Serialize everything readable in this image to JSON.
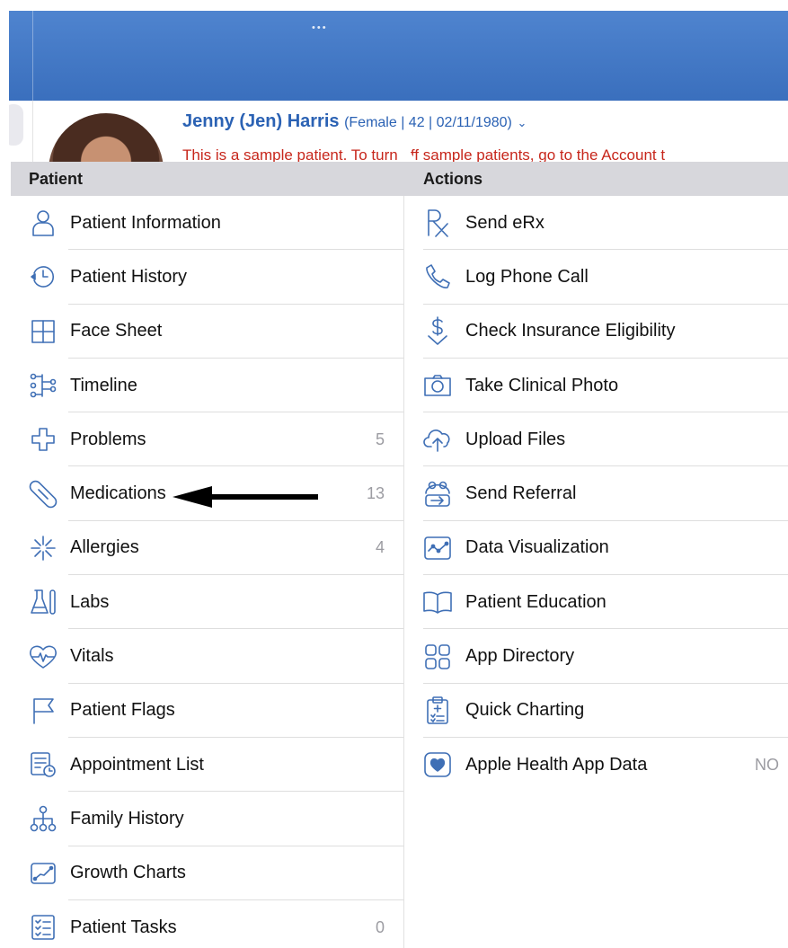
{
  "patient": {
    "name": "Jenny (Jen) Harris",
    "demographics": "(Female | 42 | 02/11/1980)",
    "chevron": "⌄",
    "sample_notice": "This is a sample patient. To turn off sample patients, go to the Account t"
  },
  "topbar": {
    "dots": "•••"
  },
  "sections": {
    "patient_header": "Patient",
    "actions_header": "Actions"
  },
  "patient_items": [
    {
      "label": "Patient Information",
      "icon": "person-icon",
      "count": ""
    },
    {
      "label": "Patient History",
      "icon": "history-clock-icon",
      "count": ""
    },
    {
      "label": "Face Sheet",
      "icon": "grid-icon",
      "count": ""
    },
    {
      "label": "Timeline",
      "icon": "timeline-icon",
      "count": ""
    },
    {
      "label": "Problems",
      "icon": "medical-cross-icon",
      "count": "5"
    },
    {
      "label": "Medications",
      "icon": "pill-icon",
      "count": "13"
    },
    {
      "label": "Allergies",
      "icon": "allergy-burst-icon",
      "count": "4"
    },
    {
      "label": "Labs",
      "icon": "lab-flask-icon",
      "count": ""
    },
    {
      "label": "Vitals",
      "icon": "heart-pulse-icon",
      "count": ""
    },
    {
      "label": "Patient Flags",
      "icon": "flag-icon",
      "count": ""
    },
    {
      "label": "Appointment List",
      "icon": "appointment-list-icon",
      "count": ""
    },
    {
      "label": "Family History",
      "icon": "family-tree-icon",
      "count": ""
    },
    {
      "label": "Growth Charts",
      "icon": "growth-chart-icon",
      "count": ""
    },
    {
      "label": "Patient Tasks",
      "icon": "task-checklist-icon",
      "count": "0"
    }
  ],
  "action_items": [
    {
      "label": "Send eRx",
      "icon": "rx-icon",
      "count": ""
    },
    {
      "label": "Log Phone Call",
      "icon": "phone-icon",
      "count": ""
    },
    {
      "label": "Check Insurance Eligibility",
      "icon": "dollar-check-icon",
      "count": ""
    },
    {
      "label": "Take Clinical Photo",
      "icon": "camera-icon",
      "count": ""
    },
    {
      "label": "Upload Files",
      "icon": "cloud-upload-icon",
      "count": ""
    },
    {
      "label": "Send Referral",
      "icon": "referral-icon",
      "count": ""
    },
    {
      "label": "Data Visualization",
      "icon": "data-chart-icon",
      "count": ""
    },
    {
      "label": "Patient Education",
      "icon": "book-icon",
      "count": ""
    },
    {
      "label": "App Directory",
      "icon": "app-grid-icon",
      "count": ""
    },
    {
      "label": "Quick Charting",
      "icon": "clipboard-icon",
      "count": ""
    },
    {
      "label": "Apple Health App Data",
      "icon": "apple-health-heart-icon",
      "count": "NO"
    }
  ],
  "colors": {
    "accent": "#3f6fb5",
    "topbar": "#4578c6",
    "warning_text": "#c7271c",
    "section_header_bg": "#d7d7dc",
    "count_text": "#9c9ca2"
  }
}
